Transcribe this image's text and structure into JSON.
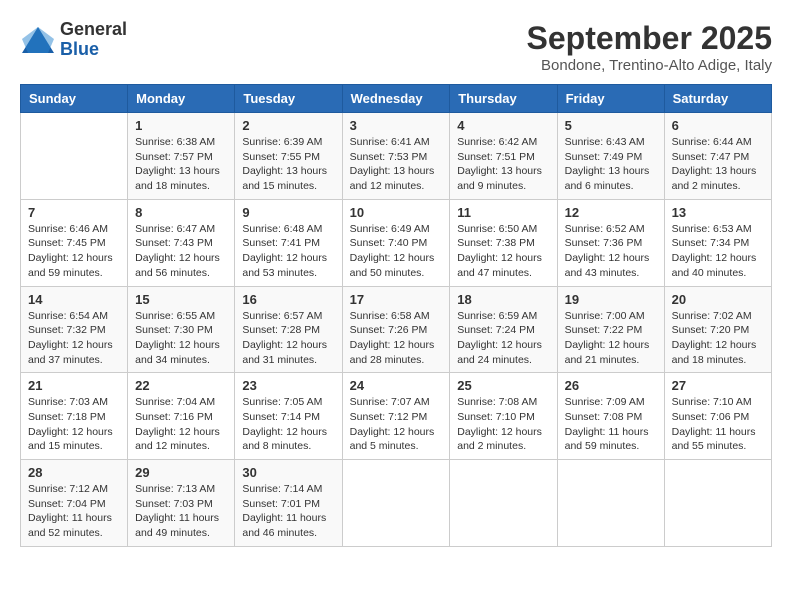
{
  "header": {
    "logo_line1": "General",
    "logo_line2": "Blue",
    "month": "September 2025",
    "location": "Bondone, Trentino-Alto Adige, Italy"
  },
  "weekdays": [
    "Sunday",
    "Monday",
    "Tuesday",
    "Wednesday",
    "Thursday",
    "Friday",
    "Saturday"
  ],
  "weeks": [
    [
      {
        "day": "",
        "sunrise": "",
        "sunset": "",
        "daylight": ""
      },
      {
        "day": "1",
        "sunrise": "Sunrise: 6:38 AM",
        "sunset": "Sunset: 7:57 PM",
        "daylight": "Daylight: 13 hours and 18 minutes."
      },
      {
        "day": "2",
        "sunrise": "Sunrise: 6:39 AM",
        "sunset": "Sunset: 7:55 PM",
        "daylight": "Daylight: 13 hours and 15 minutes."
      },
      {
        "day": "3",
        "sunrise": "Sunrise: 6:41 AM",
        "sunset": "Sunset: 7:53 PM",
        "daylight": "Daylight: 13 hours and 12 minutes."
      },
      {
        "day": "4",
        "sunrise": "Sunrise: 6:42 AM",
        "sunset": "Sunset: 7:51 PM",
        "daylight": "Daylight: 13 hours and 9 minutes."
      },
      {
        "day": "5",
        "sunrise": "Sunrise: 6:43 AM",
        "sunset": "Sunset: 7:49 PM",
        "daylight": "Daylight: 13 hours and 6 minutes."
      },
      {
        "day": "6",
        "sunrise": "Sunrise: 6:44 AM",
        "sunset": "Sunset: 7:47 PM",
        "daylight": "Daylight: 13 hours and 2 minutes."
      }
    ],
    [
      {
        "day": "7",
        "sunrise": "Sunrise: 6:46 AM",
        "sunset": "Sunset: 7:45 PM",
        "daylight": "Daylight: 12 hours and 59 minutes."
      },
      {
        "day": "8",
        "sunrise": "Sunrise: 6:47 AM",
        "sunset": "Sunset: 7:43 PM",
        "daylight": "Daylight: 12 hours and 56 minutes."
      },
      {
        "day": "9",
        "sunrise": "Sunrise: 6:48 AM",
        "sunset": "Sunset: 7:41 PM",
        "daylight": "Daylight: 12 hours and 53 minutes."
      },
      {
        "day": "10",
        "sunrise": "Sunrise: 6:49 AM",
        "sunset": "Sunset: 7:40 PM",
        "daylight": "Daylight: 12 hours and 50 minutes."
      },
      {
        "day": "11",
        "sunrise": "Sunrise: 6:50 AM",
        "sunset": "Sunset: 7:38 PM",
        "daylight": "Daylight: 12 hours and 47 minutes."
      },
      {
        "day": "12",
        "sunrise": "Sunrise: 6:52 AM",
        "sunset": "Sunset: 7:36 PM",
        "daylight": "Daylight: 12 hours and 43 minutes."
      },
      {
        "day": "13",
        "sunrise": "Sunrise: 6:53 AM",
        "sunset": "Sunset: 7:34 PM",
        "daylight": "Daylight: 12 hours and 40 minutes."
      }
    ],
    [
      {
        "day": "14",
        "sunrise": "Sunrise: 6:54 AM",
        "sunset": "Sunset: 7:32 PM",
        "daylight": "Daylight: 12 hours and 37 minutes."
      },
      {
        "day": "15",
        "sunrise": "Sunrise: 6:55 AM",
        "sunset": "Sunset: 7:30 PM",
        "daylight": "Daylight: 12 hours and 34 minutes."
      },
      {
        "day": "16",
        "sunrise": "Sunrise: 6:57 AM",
        "sunset": "Sunset: 7:28 PM",
        "daylight": "Daylight: 12 hours and 31 minutes."
      },
      {
        "day": "17",
        "sunrise": "Sunrise: 6:58 AM",
        "sunset": "Sunset: 7:26 PM",
        "daylight": "Daylight: 12 hours and 28 minutes."
      },
      {
        "day": "18",
        "sunrise": "Sunrise: 6:59 AM",
        "sunset": "Sunset: 7:24 PM",
        "daylight": "Daylight: 12 hours and 24 minutes."
      },
      {
        "day": "19",
        "sunrise": "Sunrise: 7:00 AM",
        "sunset": "Sunset: 7:22 PM",
        "daylight": "Daylight: 12 hours and 21 minutes."
      },
      {
        "day": "20",
        "sunrise": "Sunrise: 7:02 AM",
        "sunset": "Sunset: 7:20 PM",
        "daylight": "Daylight: 12 hours and 18 minutes."
      }
    ],
    [
      {
        "day": "21",
        "sunrise": "Sunrise: 7:03 AM",
        "sunset": "Sunset: 7:18 PM",
        "daylight": "Daylight: 12 hours and 15 minutes."
      },
      {
        "day": "22",
        "sunrise": "Sunrise: 7:04 AM",
        "sunset": "Sunset: 7:16 PM",
        "daylight": "Daylight: 12 hours and 12 minutes."
      },
      {
        "day": "23",
        "sunrise": "Sunrise: 7:05 AM",
        "sunset": "Sunset: 7:14 PM",
        "daylight": "Daylight: 12 hours and 8 minutes."
      },
      {
        "day": "24",
        "sunrise": "Sunrise: 7:07 AM",
        "sunset": "Sunset: 7:12 PM",
        "daylight": "Daylight: 12 hours and 5 minutes."
      },
      {
        "day": "25",
        "sunrise": "Sunrise: 7:08 AM",
        "sunset": "Sunset: 7:10 PM",
        "daylight": "Daylight: 12 hours and 2 minutes."
      },
      {
        "day": "26",
        "sunrise": "Sunrise: 7:09 AM",
        "sunset": "Sunset: 7:08 PM",
        "daylight": "Daylight: 11 hours and 59 minutes."
      },
      {
        "day": "27",
        "sunrise": "Sunrise: 7:10 AM",
        "sunset": "Sunset: 7:06 PM",
        "daylight": "Daylight: 11 hours and 55 minutes."
      }
    ],
    [
      {
        "day": "28",
        "sunrise": "Sunrise: 7:12 AM",
        "sunset": "Sunset: 7:04 PM",
        "daylight": "Daylight: 11 hours and 52 minutes."
      },
      {
        "day": "29",
        "sunrise": "Sunrise: 7:13 AM",
        "sunset": "Sunset: 7:03 PM",
        "daylight": "Daylight: 11 hours and 49 minutes."
      },
      {
        "day": "30",
        "sunrise": "Sunrise: 7:14 AM",
        "sunset": "Sunset: 7:01 PM",
        "daylight": "Daylight: 11 hours and 46 minutes."
      },
      {
        "day": "",
        "sunrise": "",
        "sunset": "",
        "daylight": ""
      },
      {
        "day": "",
        "sunrise": "",
        "sunset": "",
        "daylight": ""
      },
      {
        "day": "",
        "sunrise": "",
        "sunset": "",
        "daylight": ""
      },
      {
        "day": "",
        "sunrise": "",
        "sunset": "",
        "daylight": ""
      }
    ]
  ]
}
